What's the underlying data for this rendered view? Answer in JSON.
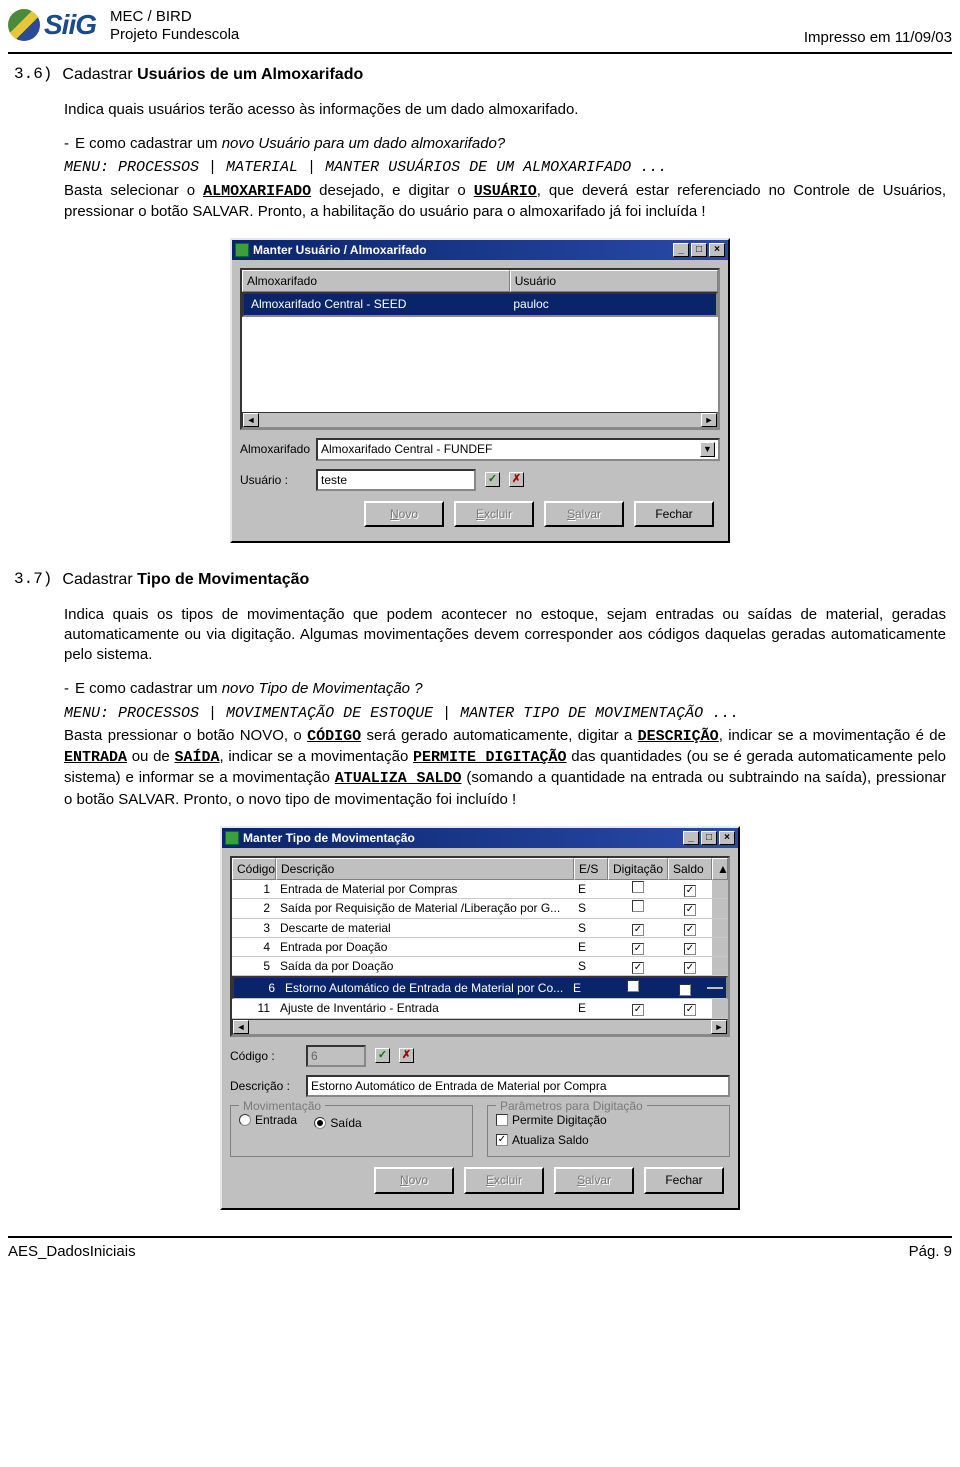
{
  "header": {
    "logo_text": "SiiG",
    "line1": "MEC / BIRD",
    "line2": "Projeto Fundescola",
    "right": "Impresso em 11/09/03"
  },
  "section36": {
    "num": "3.6)",
    "title": "Cadastrar Usuários de um  Almoxarifado",
    "intro": "Indica quais usuários terão acesso às informações de um dado almoxarifado.",
    "q_prefix": "-  E como cadastrar um ",
    "q_italic": "novo Usuário para um dado almoxarifado?",
    "menu_label": "MENU:",
    "menu_path": "PROCESSOS | MATERIAL | MANTER USUÁRIOS DE UM ALMOXARIFADO ...",
    "body_a": "Basta selecionar o ",
    "body_b": "ALMOXARIFADO",
    "body_c": " desejado, e digitar o ",
    "body_d": "USUÁRIO",
    "body_e": ", que deverá estar referenciado no Controle de Usuários, pressionar o botão SALVAR. Pronto, a habilitação do usuário para o almoxarifado já foi incluída !"
  },
  "win1": {
    "title": "Manter Usuário / Almoxarifado",
    "col1": "Almoxarifado",
    "col2": "Usuário",
    "row_c1": "Almoxarifado Central - SEED",
    "row_c2": "pauloc",
    "lbl_almox": "Almoxarifado",
    "val_almox": "Almoxarifado Central - FUNDEF",
    "lbl_user": "Usuário :",
    "val_user": "teste",
    "btn_novo": "Novo",
    "btn_excluir": "Excluir",
    "btn_salvar": "Salvar",
    "btn_fechar": "Fechar"
  },
  "section37": {
    "num": "3.7)",
    "title": "Cadastrar Tipo de Movimentação",
    "intro": "Indica quais os tipos de movimentação que podem acontecer no estoque, sejam entradas ou saídas de material, geradas automaticamente ou via digitação. Algumas movimentações devem corresponder aos códigos daquelas geradas automaticamente pelo sistema.",
    "q_prefix": "-  E como cadastrar um ",
    "q_italic": "novo Tipo de Movimentação ?",
    "menu_label": "MENU:",
    "menu_path": "PROCESSOS | MOVIMENTAÇÃO DE ESTOQUE | MANTER TIPO DE MOVIMENTAÇÃO ...",
    "body_a": "Basta pressionar o botão NOVO, o ",
    "body_b": "CÓDIGO",
    "body_c": " será gerado automaticamente, digitar a ",
    "body_d": "DESCRIÇÃO",
    "body_e": ", indicar se a movimentação é de ",
    "body_f": "ENTRADA",
    "body_g": " ou de ",
    "body_h": "SAÍDA",
    "body_i": ", indicar se a movimentação ",
    "body_j": "PERMITE DIGITAÇÃO",
    "body_k": " das quantidades (ou se é gerada automaticamente pelo sistema) e informar se a movimentação ",
    "body_l": "ATUALIZA SALDO",
    "body_m": " (somando a quantidade na entrada ou subtraindo na saída), pressionar o botão SALVAR. Pronto, o novo tipo de movimentação foi incluído !"
  },
  "win2": {
    "title": "Manter Tipo de Movimentação",
    "col_codigo": "Código",
    "col_desc": "Descrição",
    "col_es": "E/S",
    "col_dig": "Digitação",
    "col_saldo": "Saldo",
    "rows": [
      {
        "cod": "1",
        "desc": "Entrada de Material por Compras",
        "es": "E",
        "dig": false,
        "saldo": true
      },
      {
        "cod": "2",
        "desc": "Saída por Requisição de Material /Liberação por G...",
        "es": "S",
        "dig": false,
        "saldo": true
      },
      {
        "cod": "3",
        "desc": "Descarte de material",
        "es": "S",
        "dig": true,
        "saldo": true
      },
      {
        "cod": "4",
        "desc": "Entrada por Doação",
        "es": "E",
        "dig": true,
        "saldo": true
      },
      {
        "cod": "5",
        "desc": "Saída da por Doação",
        "es": "S",
        "dig": true,
        "saldo": true
      },
      {
        "cod": "6",
        "desc": "Estorno Automático de Entrada de Material por Co...",
        "es": "E",
        "dig": false,
        "saldo": true
      },
      {
        "cod": "11",
        "desc": "Ajuste de Inventário - Entrada",
        "es": "E",
        "dig": true,
        "saldo": true
      }
    ],
    "lbl_codigo": "Código :",
    "val_codigo": "6",
    "lbl_desc": "Descrição :",
    "val_desc": "Estorno Automático de Entrada de Material por Compra",
    "fs_mov": "Movimentação",
    "rad_entrada": "Entrada",
    "rad_saida": "Saída",
    "fs_param": "Parâmetros para Digitação",
    "chk_permite": "Permite Digitação",
    "chk_atualiza": "Atualiza Saldo",
    "btn_novo": "Novo",
    "btn_excluir": "Excluir",
    "btn_salvar": "Salvar",
    "btn_fechar": "Fechar"
  },
  "footer": {
    "left": "AES_DadosIniciais",
    "right": "Pág.  9"
  }
}
